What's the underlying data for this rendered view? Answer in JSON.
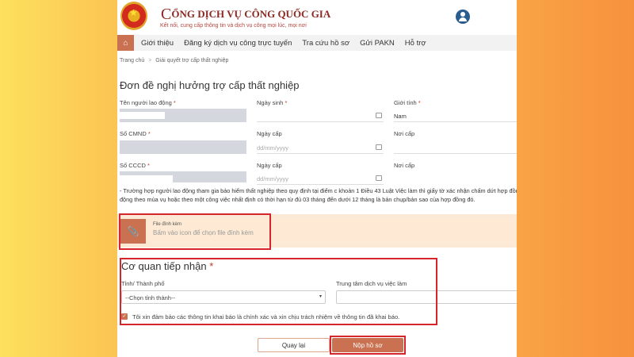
{
  "header": {
    "brand": "CỔNG DỊCH VỤ CÔNG QUỐC GIA",
    "brand_first": "C",
    "brand_rest": "ỔNG DỊCH VỤ CÔNG QUỐC GIA",
    "slogan": "Kết nối, cung cấp thông tin và dịch vụ công mọi lúc, mọi nơi"
  },
  "nav": {
    "items": [
      "Giới thiệu",
      "Đăng ký dịch vụ công trực tuyến",
      "Tra cứu hồ sơ",
      "Gửi PAKN",
      "Hỗ trợ"
    ]
  },
  "breadcrumb": {
    "home": "Trang chủ",
    "sep": ">",
    "current": "Giải quyết trợ cấp thất nghiệp"
  },
  "form": {
    "title": "Đơn đề nghị hưởng trợ cấp thất nghiệp",
    "required_mark": "*",
    "name_label": "Tên người lao động",
    "dob_label": "Ngày sinh",
    "gender_label": "Giới tính",
    "gender_value": "Nam",
    "cmnd_label": "Số CMND",
    "cmnd_date_label": "Ngày cấp",
    "cmnd_date_placeholder": "dd/mm/yyyy",
    "cmnd_place_label": "Nơi cấp",
    "cccd_label": "Số CCCD",
    "cccd_date_label": "Ngày cấp",
    "cccd_date_placeholder": "dd/mm/yyyy",
    "cccd_place_label": "Nơi cấp",
    "note": "- Trường hợp người lao động tham gia bảo hiểm thất nghiệp theo quy định tại điểm c khoản 1 Điều 43 Luật Việc làm thì giấy tờ xác nhận chấm dứt hợp đồng lao động theo mùa vụ hoặc theo một công việc nhất định có thời hạn từ đủ 03 tháng đến dưới 12 tháng là bản chụp/bản sao của hợp đồng đó.",
    "attach_label": "File đính kèm",
    "attach_hint": "Bấm vào icon để chọn file đính kèm"
  },
  "agency": {
    "title": "Cơ quan tiếp nhận",
    "province_label": "Tỉnh/ Thành phố",
    "province_value": "--Chọn tỉnh thành--",
    "center_label": "Trung tâm dịch vụ việc làm",
    "confirm": "Tôi xin đảm bảo các thông tin khai báo là chính xác và xin chịu trách nhiệm về thông tin đã khai báo.",
    "confirm_checked": true
  },
  "buttons": {
    "back": "Quay lại",
    "submit": "Nộp hồ sơ"
  },
  "colors": {
    "accent": "#c97150",
    "highlight": "#d6262c"
  }
}
